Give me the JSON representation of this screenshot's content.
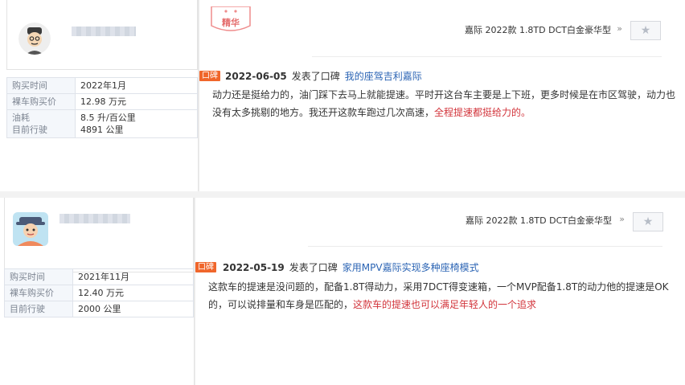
{
  "posts": [
    {
      "badge": "精华",
      "info": [
        {
          "k": "购买时间",
          "v": "2022年1月"
        },
        {
          "k": "裸车购买价",
          "v": "12.98 万元"
        },
        {
          "k": "油耗\n目前行驶",
          "v": "8.5 升/百公里\n4891 公里"
        }
      ],
      "model": "嘉际 2022款 1.8TD DCT白金豪华型",
      "more": "»",
      "fav": "★",
      "tag": "口碑",
      "date": "2022-06-05",
      "action": "发表了口碑",
      "title": "我的座驾吉利嘉际",
      "text": "动力还是挺给力的，油门踩下去马上就能提速。平时开这台车主要是上下班，更多时候是在市区驾驶，动力也没有太多挑剔的地方。我还开这款车跑过几次高速，",
      "highlight": "全程提速都挺给力的。"
    },
    {
      "info": [
        {
          "k": "购买时间",
          "v": "2021年11月"
        },
        {
          "k": "裸车购买价",
          "v": "12.40 万元"
        },
        {
          "k": "目前行驶",
          "v": "2000 公里"
        }
      ],
      "model": "嘉际 2022款 1.8TD DCT白金豪华型",
      "more": "»",
      "fav": "★",
      "tag": "口碑",
      "date": "2022-05-19",
      "action": "发表了口碑",
      "title": "家用MPV嘉际实现多种座椅模式",
      "text": "这款车的提速是没问题的，配备1.8T得动力，采用7DCT得变速箱，一个MVP配备1.8T的动力他的提速是OK的，可以说排量和车身是匹配的，",
      "highlight": "这款车的提速也可以满足年轻人的一个追求"
    }
  ],
  "colors": {
    "accent": "#f0662b",
    "link": "#2b64b4",
    "highlight": "#d2343b"
  }
}
